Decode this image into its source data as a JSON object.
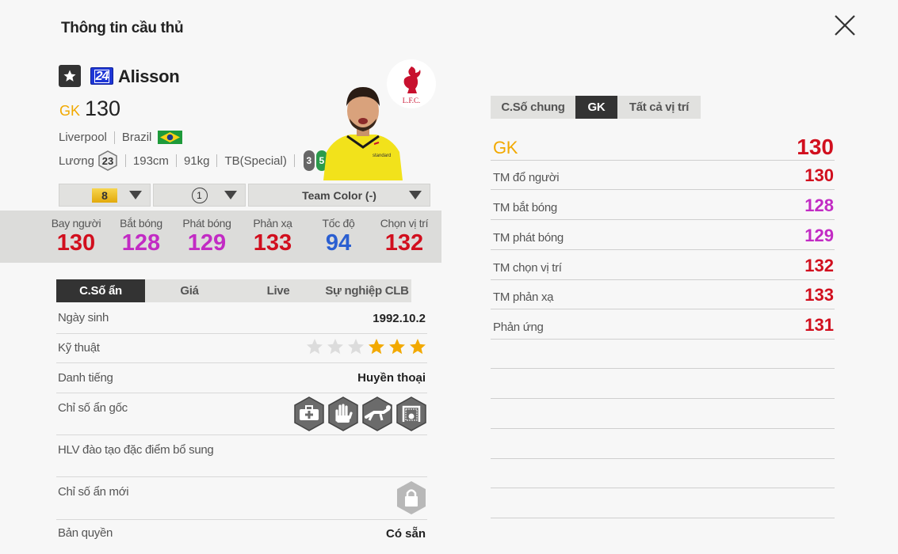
{
  "page": {
    "title": "Thông tin cầu thủ"
  },
  "player": {
    "season_number": "24",
    "name": "Alisson",
    "position": "GK",
    "ovr": "130",
    "club": "Liverpool",
    "nation": "Brazil",
    "salary_label": "Lương",
    "salary": "23",
    "height": "193cm",
    "weight": "91kg",
    "body_type": "TB(Special)",
    "left_foot": "3",
    "right_foot": "5",
    "club_logo_text": "L.F.C."
  },
  "selectors": {
    "grade": "8",
    "level": "1",
    "team_color": "Team Color (-)"
  },
  "key_stats": [
    {
      "label": "Bay người",
      "value": "130",
      "color": "#d10f1e"
    },
    {
      "label": "Bắt bóng",
      "value": "128",
      "color": "#c22bc4"
    },
    {
      "label": "Phát bóng",
      "value": "129",
      "color": "#c22bc4"
    },
    {
      "label": "Phản xạ",
      "value": "133",
      "color": "#d10f1e"
    },
    {
      "label": "Tốc độ",
      "value": "94",
      "color": "#2b5fd1"
    },
    {
      "label": "Chọn vị trí",
      "value": "132",
      "color": "#d10f1e"
    }
  ],
  "tabs": [
    "C.Số ẩn",
    "Giá",
    "Live",
    "Sự nghiệp CLB"
  ],
  "details": {
    "birth_label": "Ngày sinh",
    "birth_value": "1992.10.2",
    "skill_label": "Kỹ thuật",
    "skill_stars": 3,
    "skill_max": 6,
    "fame_label": "Danh tiếng",
    "fame_value": "Huyền thoại",
    "hidden_label": "Chỉ số ẩn gốc",
    "hidden_icons": [
      "medical-kit-icon",
      "goalkeeper-glove-icon",
      "diving-goalkeeper-icon",
      "goal-net-icon"
    ],
    "coach_label": "HLV đào tạo đặc điểm bổ sung",
    "new_hidden_label": "Chỉ số ẩn mới",
    "license_label": "Bản quyền",
    "license_value": "Có sẵn"
  },
  "right_tabs": [
    "C.Số chung",
    "GK",
    "Tất cả vị trí"
  ],
  "right_stats": {
    "pos": "GK",
    "pos_value": "130",
    "rows": [
      {
        "label": "TM đổ người",
        "value": "130",
        "color": "#d10f1e"
      },
      {
        "label": "TM bắt bóng",
        "value": "128",
        "color": "#c22bc4"
      },
      {
        "label": "TM phát bóng",
        "value": "129",
        "color": "#c22bc4"
      },
      {
        "label": "TM chọn vị trí",
        "value": "132",
        "color": "#d10f1e"
      },
      {
        "label": "TM phản xạ",
        "value": "133",
        "color": "#d10f1e"
      },
      {
        "label": "Phản ứng",
        "value": "131",
        "color": "#d10f1e"
      }
    ]
  },
  "colors": {
    "accent": "#f2a900",
    "red": "#d10f1e",
    "magenta": "#c22bc4",
    "blue": "#2b5fd1",
    "dark": "#333333"
  }
}
